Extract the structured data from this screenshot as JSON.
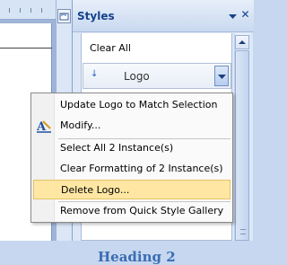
{
  "pane": {
    "title": "Styles",
    "close_glyph": "✕"
  },
  "styles_list": {
    "clear_all": "Clear All",
    "selected_style": "Logo",
    "heading_preview": "Heading 2"
  },
  "context_menu": {
    "items": [
      {
        "label": "Update Logo to Match Selection",
        "icon": "none"
      },
      {
        "label": "Modify...",
        "icon": "modify-style-icon"
      },
      {
        "label": "Select All 2 Instance(s)",
        "icon": "none"
      },
      {
        "label": "Clear Formatting of 2 Instance(s)",
        "icon": "none"
      },
      {
        "label": "Delete Logo...",
        "icon": "none",
        "highlighted": true
      },
      {
        "label": "Remove from Quick Style Gallery",
        "icon": "none"
      }
    ]
  },
  "colors": {
    "pane_title": "#15428b",
    "highlight": "#ffe7a3",
    "heading_preview": "#3b6db3"
  }
}
